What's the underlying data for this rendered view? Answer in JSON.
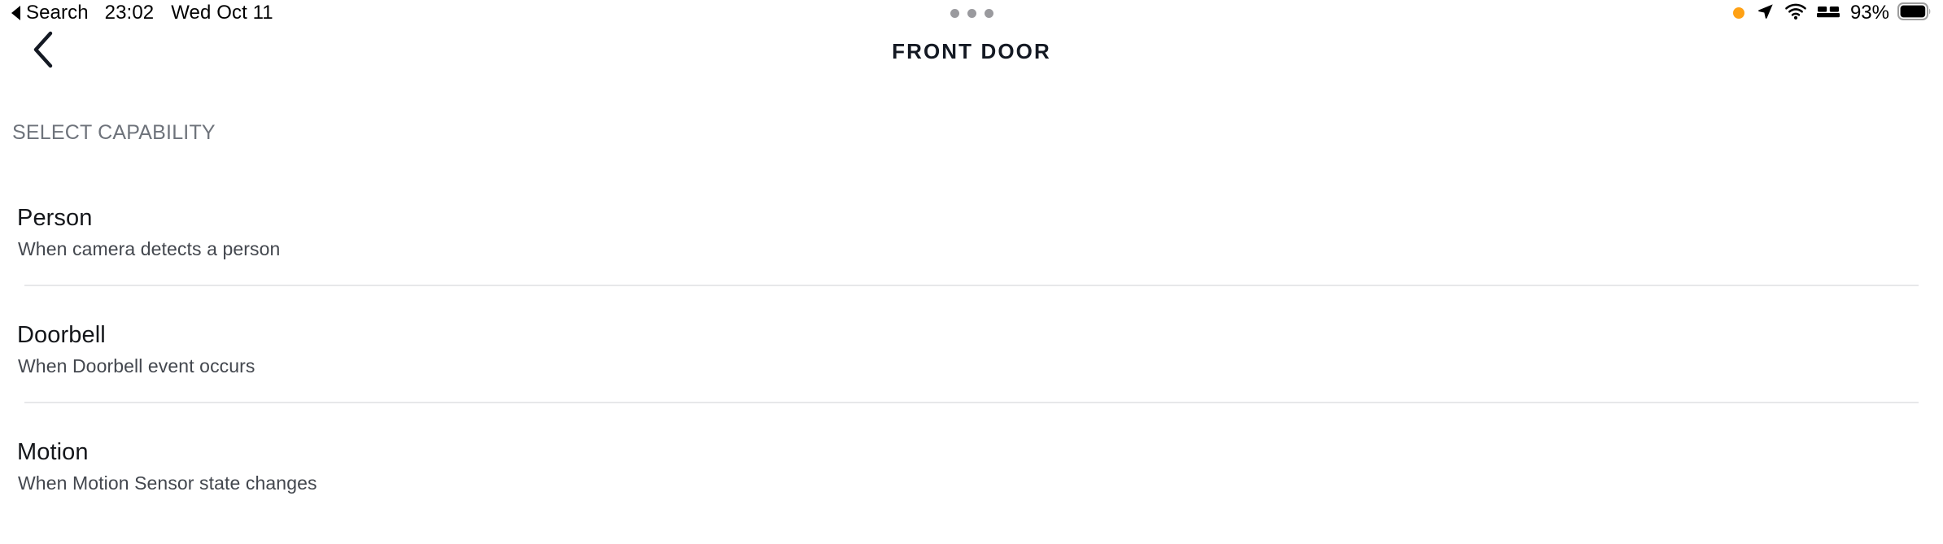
{
  "status_bar": {
    "back_app_label": "Search",
    "back_indicator_icon": "triangle-left-icon",
    "time": "23:02",
    "date": "Wed Oct 11",
    "multitask_dots_icon": "multitask-dots-icon",
    "recording_dot_icon": "microphone-in-use-dot",
    "recording_dot_color": "#FFA114",
    "location_icon": "location-arrow-icon",
    "wifi_icon": "wifi-icon",
    "focus_icon": "bed-sleep-focus-icon",
    "battery_percent": "93%",
    "battery_icon": "battery-icon"
  },
  "nav_bar": {
    "back_icon": "chevron-left-icon",
    "title": "FRONT DOOR"
  },
  "content": {
    "section_label": "SELECT CAPABILITY",
    "capabilities": [
      {
        "title": "Person",
        "subtitle": "When camera detects a person"
      },
      {
        "title": "Doorbell",
        "subtitle": "When Doorbell event occurs"
      },
      {
        "title": "Motion",
        "subtitle": "When Motion Sensor state changes"
      }
    ]
  },
  "colors": {
    "background": "#FFFFFF",
    "title_text": "#141923",
    "primary_text": "#14161A",
    "secondary_text": "#43474E",
    "muted_text": "#6E737B",
    "divider": "#E7E8EA",
    "accent_orange": "#FFA114"
  }
}
